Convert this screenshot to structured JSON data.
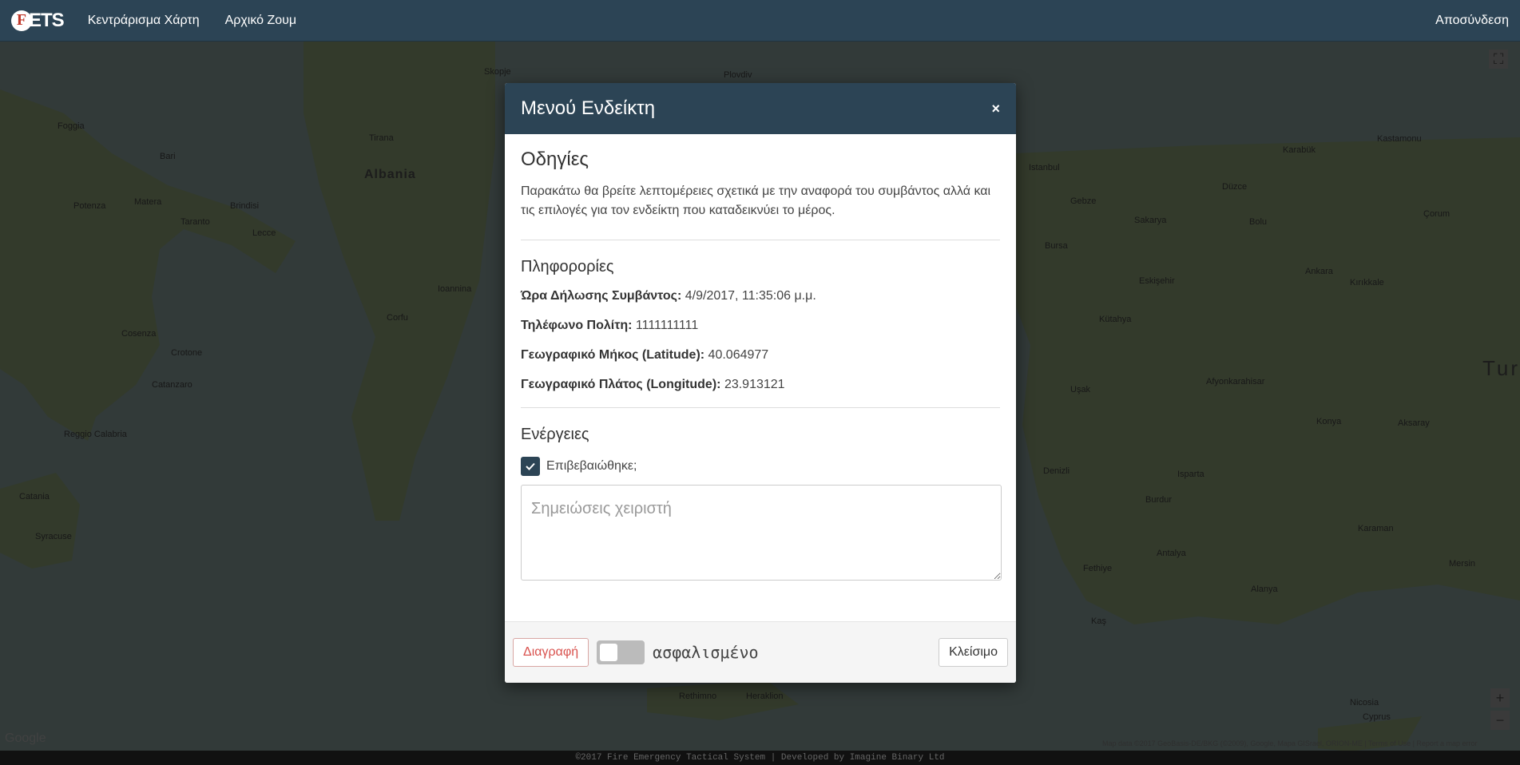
{
  "navbar": {
    "brand_logo_letter": "F",
    "brand_text": "ETS",
    "links": [
      "Κεντράρισμα Χάρτη",
      "Αρχικό Ζουμ"
    ],
    "logout": "Αποσύνδεση"
  },
  "map": {
    "labels": [
      "Albania",
      "Tirana",
      "Bari",
      "Foggia",
      "Potenza",
      "Matera",
      "Taranto",
      "Brindisi",
      "Lecce",
      "Cosenza",
      "Crotone",
      "Catanzaro",
      "Reggio Calabria",
      "Catania",
      "Syracuse",
      "Skopje",
      "Plovdiv",
      "Istanbul",
      "Bursa",
      "Eskişehir",
      "Ankara",
      "Konya",
      "Antalya",
      "Denizli",
      "Kastamonu",
      "Karabük",
      "Sakarya",
      "Aksaray",
      "Karaman",
      "Mersin",
      "Nicosia",
      "Cyprus",
      "Tur",
      "Kütahya",
      "Uşak",
      "Isparta",
      "Burdur",
      "Afyonkarahisar",
      "Corfu",
      "Ioannina",
      "Rethimno",
      "Heraklion",
      "Düzce",
      "Bolu",
      "Gebze",
      "Çorum",
      "Kırıkkale",
      "Fethiye",
      "Alanya",
      "Kaş"
    ],
    "attribution": "Map data ©2017 GeoBasis-DE/BKG (©2009), Google, Mapa GISrael, ORION-ME | Terms of Use | Report a map error",
    "google_logo": "Google",
    "zoom_in": "+",
    "zoom_out": "−",
    "fullscreen": "⛶"
  },
  "modal": {
    "title": "Μενού Ενδείκτη",
    "close": "×",
    "instructions_title": "Οδηγίες",
    "instructions_text": "Παρακάτω θα βρείτε λεπτομέρειες σχετικά με την αναφορά του συμβάντος αλλά και τις επιλογές για τον ενδείκτη που καταδεικνύει το μέρος.",
    "info_title": "Πληφορορίες",
    "info": [
      {
        "label": "Ώρα Δήλωσης Συμβάντος:",
        "value": "4/9/2017, 11:35:06 μ.μ."
      },
      {
        "label": "Τηλέφωνο Πολίτη:",
        "value": "1111111111"
      },
      {
        "label": "Γεωγραφικό Μήκος (Latitude):",
        "value": "40.064977"
      },
      {
        "label": "Γεωγραφικό Πλάτος (Longitude):",
        "value": "23.913121"
      }
    ],
    "actions_title": "Ενέργειες",
    "confirmed_label": "Επιβεβαιώθηκε;",
    "confirmed": true,
    "notes_placeholder": "Σημειώσεις χειριστή",
    "notes_value": "",
    "delete_label": "Διαγραφή",
    "toggle_label": "ασφαλισμένο",
    "toggle_on": false,
    "close_label": "Κλείσιμο"
  },
  "footer": {
    "text": "©2017 Fire Emergency Tactical System | Developed by Imagine Binary Ltd"
  },
  "colors": {
    "navbar": "#2c4455",
    "modal_header": "#2c4455",
    "danger": "#d9534f"
  }
}
